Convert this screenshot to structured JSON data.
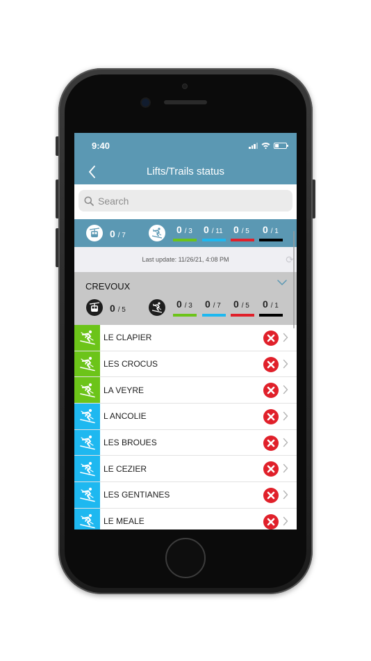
{
  "status_bar": {
    "time": "9:40"
  },
  "nav": {
    "title": "Lifts/Trails status",
    "back_icon": "chevron-left-icon"
  },
  "search": {
    "placeholder": "Search",
    "value": ""
  },
  "colors": {
    "header": "#5b98b3",
    "green": "#6cc419",
    "blue": "#1eb8f0",
    "red": "#e0202a",
    "black": "#000000",
    "region_bg": "#c7c7c7"
  },
  "summary": {
    "lifts": {
      "open": "0",
      "total": "/ 7"
    },
    "trails": [
      {
        "open": "0",
        "total": "/ 3",
        "color": "green"
      },
      {
        "open": "0",
        "total": "/ 11",
        "color": "blue"
      },
      {
        "open": "0",
        "total": "/ 5",
        "color": "red"
      },
      {
        "open": "0",
        "total": "/ 1",
        "color": "black"
      }
    ]
  },
  "last_update": "Last update: 11/26/21, 4:08 PM",
  "region": {
    "name": "CREVOUX",
    "lifts": {
      "open": "0",
      "total": "/ 5"
    },
    "trails": [
      {
        "open": "0",
        "total": "/ 3",
        "color": "green"
      },
      {
        "open": "0",
        "total": "/ 7",
        "color": "blue"
      },
      {
        "open": "0",
        "total": "/ 5",
        "color": "red"
      },
      {
        "open": "0",
        "total": "/ 1",
        "color": "black"
      }
    ]
  },
  "trails": [
    {
      "name": "LE CLAPIER",
      "difficulty": "green",
      "status": "closed"
    },
    {
      "name": "LES CROCUS",
      "difficulty": "green",
      "status": "closed"
    },
    {
      "name": "LA VEYRE",
      "difficulty": "green",
      "status": "closed"
    },
    {
      "name": "L ANCOLIE",
      "difficulty": "blue",
      "status": "closed"
    },
    {
      "name": "LES BROUES",
      "difficulty": "blue",
      "status": "closed"
    },
    {
      "name": "LE CEZIER",
      "difficulty": "blue",
      "status": "closed"
    },
    {
      "name": "LES GENTIANES",
      "difficulty": "blue",
      "status": "closed"
    },
    {
      "name": "LE MEALE",
      "difficulty": "blue",
      "status": "closed"
    }
  ]
}
